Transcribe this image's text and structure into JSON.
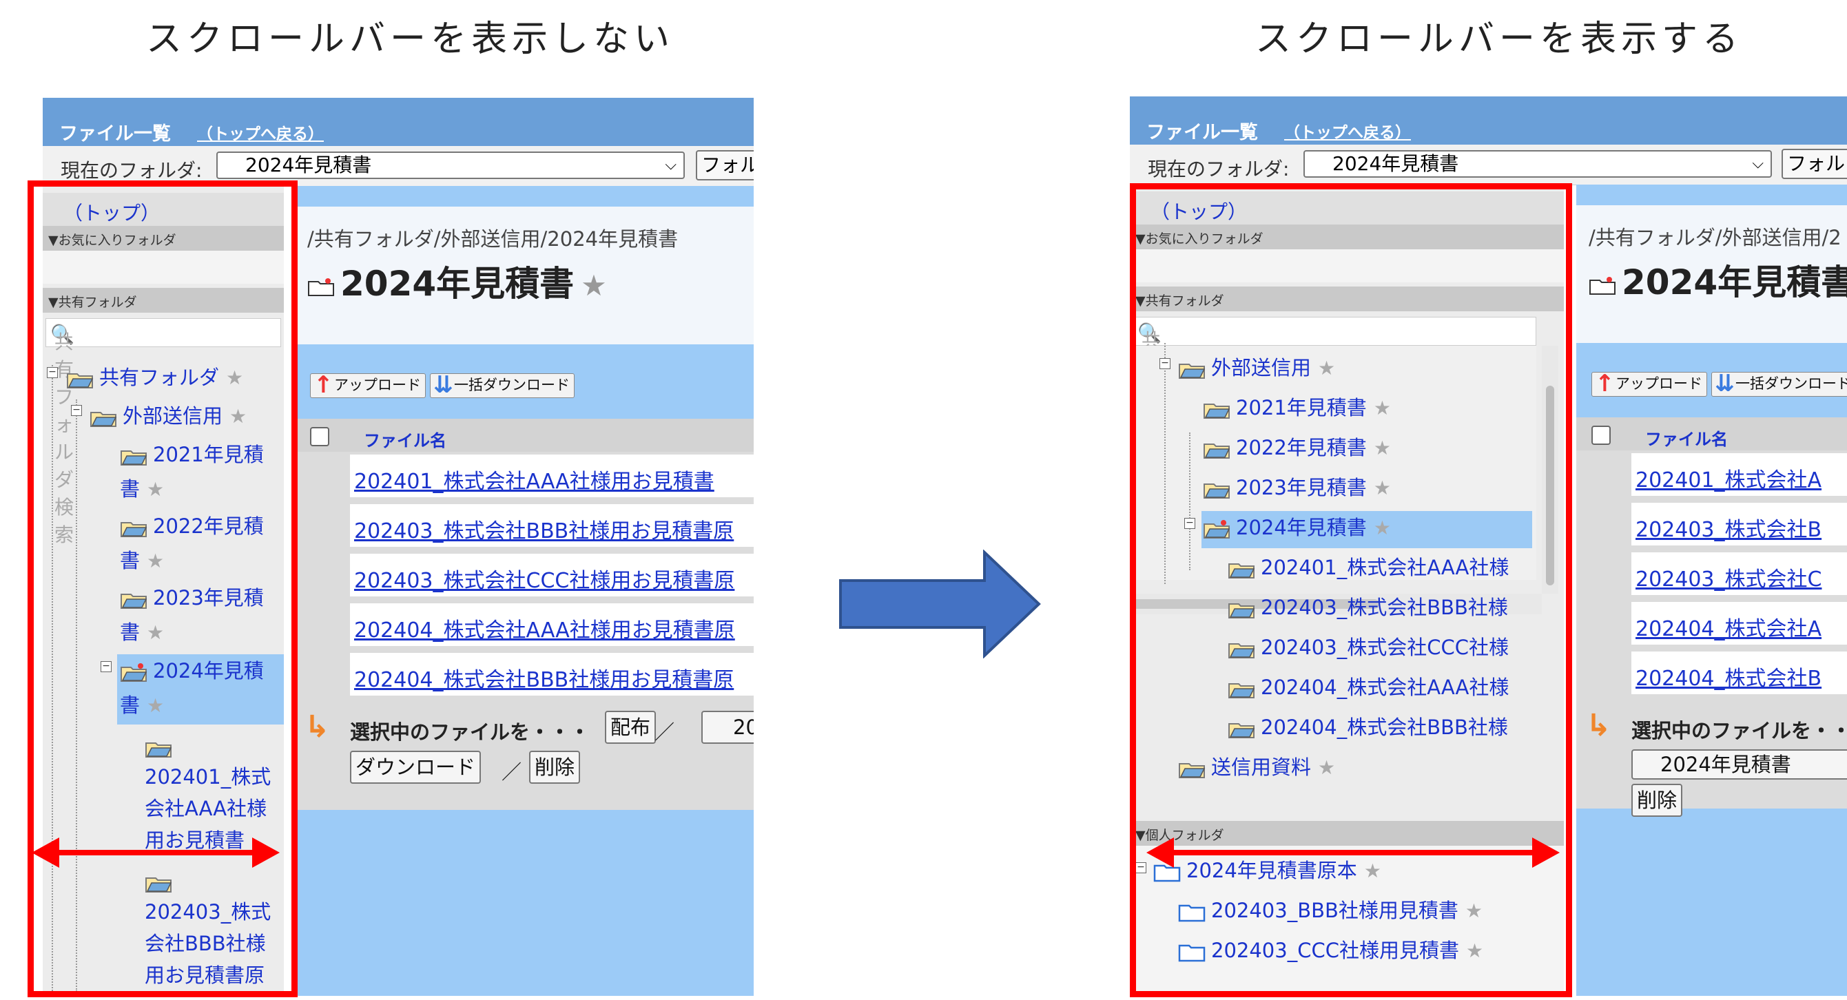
{
  "headings": {
    "left": "スクロールバーを表示しない",
    "right": "スクロールバーを表示する"
  },
  "app": {
    "title": "ファイル一覧",
    "back_link": "（トップへ戻る）",
    "current_folder_label": "現在のフォルダ:",
    "current_folder_value": "2024年見積書",
    "folder_button": "フォル"
  },
  "sidebar": {
    "top_link": "（トップ）",
    "favorites_section": "▼お気に入りフォルダ",
    "shared_section": "▼共有フォルダ",
    "search_placeholder": "共有フォルダ検索",
    "personal_section": "▼個人フォルダ"
  },
  "left_tree": [
    {
      "label": "共有フォルダ",
      "star": "★"
    },
    {
      "label": "外部送信用",
      "star": "★"
    },
    {
      "label": "2021年見積",
      "cont": "書",
      "star": "★"
    },
    {
      "label": "2022年見積",
      "cont": "書",
      "star": "★"
    },
    {
      "label": "2023年見積",
      "cont": "書",
      "star": "★"
    },
    {
      "label": "2024年見積",
      "cont": "書",
      "star": "★"
    },
    {
      "line1": "202401_株式",
      "line2": "会社AAA社様",
      "line3": "用お見積書"
    },
    {
      "line1": "202403_株式",
      "line2": "会社BBB社様",
      "line3": "用お見積書原"
    }
  ],
  "right_tree": [
    {
      "label": "外部送信用",
      "star": "★"
    },
    {
      "label": "2021年見積書",
      "star": "★"
    },
    {
      "label": "2022年見積書",
      "star": "★"
    },
    {
      "label": "2023年見積書",
      "star": "★"
    },
    {
      "label": "2024年見積書",
      "star": "★"
    },
    {
      "label": "202401_株式会社AAA社様"
    },
    {
      "label": "202403_株式会社BBB社様"
    },
    {
      "label": "202403_株式会社CCC社様"
    },
    {
      "label": "202404_株式会社AAA社様"
    },
    {
      "label": "202404_株式会社BBB社様"
    },
    {
      "label": "送信用資料",
      "star": "★"
    }
  ],
  "right_personal": [
    {
      "label": "2024年見積書原本",
      "star": "★"
    },
    {
      "label": "202403_BBB社様用見積書",
      "star": "★"
    },
    {
      "label": "202403_CCC社様用見積書",
      "star": "★"
    }
  ],
  "main": {
    "breadcrumb_left": "/共有フォルダ/外部送信用/2024年見積書",
    "breadcrumb_right": "/共有フォルダ/外部送信用/2",
    "title": "2024年見積書",
    "title_star": "★",
    "upload": "アップロード",
    "bulk_download": "一括ダウンロード",
    "column_filename": "ファイル名",
    "files_left": [
      "202401_株式会社AAA社様用お見積書",
      "202403_株式会社BBB社様用お見積書原",
      "202403_株式会社CCC社様用お見積書原",
      "202404_株式会社AAA社様用お見積書原",
      "202404_株式会社BBB社様用お見積書原"
    ],
    "files_right": [
      "202401_株式会社A",
      "202403_株式会社B",
      "202403_株式会社C",
      "202404_株式会社A",
      "202404_株式会社B"
    ],
    "selected_files_left": "選択中のファイルを・・・",
    "selected_files_right": "選択中のファイルを・・",
    "distribute": "配布",
    "dest_partial": "20",
    "dest_right": "2024年見積書",
    "download": "ダウンロード",
    "delete": "削除",
    "slash": "／"
  },
  "colors": {
    "accent_red": "#ff0000",
    "arrow_blue": "#4472c4",
    "header_blue": "#6a9fd8",
    "link_blue": "#1a33cc",
    "selection_blue": "#9ccaf5"
  }
}
